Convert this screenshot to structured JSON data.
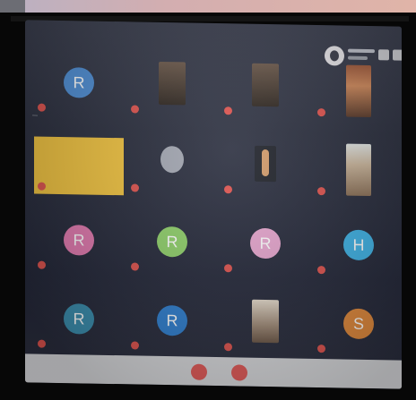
{
  "colors": {
    "screen_bg": "#2b2f3f",
    "active_speaker": "#f2c440",
    "mic_muted": "#e0544f",
    "avatar_colors": [
      "#4f8fd6",
      "#e37ab0",
      "#8fd06a",
      "#e7a6cf",
      "#3fb4e8",
      "#3b8fb0",
      "#2f7fd0",
      "#e28a3c"
    ]
  },
  "host": {
    "icon": "person-avatar-icon"
  },
  "toolbar": {
    "buttons": [
      "layout-icon",
      "fullscreen-icon"
    ]
  },
  "participants": [
    {
      "initial": "R",
      "name": "",
      "kind": "avatar",
      "color_index": 0
    },
    {
      "initial": "",
      "name": "",
      "kind": "photo"
    },
    {
      "initial": "",
      "name": "",
      "kind": "photo"
    },
    {
      "initial": "",
      "name": "",
      "kind": "portrait"
    },
    {
      "initial": "",
      "name": "",
      "kind": "active"
    },
    {
      "initial": "",
      "name": "",
      "kind": "photo-round"
    },
    {
      "initial": "",
      "name": "",
      "kind": "icon"
    },
    {
      "initial": "",
      "name": "",
      "kind": "portrait2"
    },
    {
      "initial": "R",
      "name": "",
      "kind": "avatar",
      "color_index": 1
    },
    {
      "initial": "R",
      "name": "",
      "kind": "avatar",
      "color_index": 2
    },
    {
      "initial": "R",
      "name": "",
      "kind": "avatar",
      "color_index": 3
    },
    {
      "initial": "H",
      "name": "",
      "kind": "avatar",
      "color_index": 4
    },
    {
      "initial": "R",
      "name": "",
      "kind": "avatar",
      "color_index": 5
    },
    {
      "initial": "R",
      "name": "",
      "kind": "avatar",
      "color_index": 6
    },
    {
      "initial": "",
      "name": "",
      "kind": "photo-light"
    },
    {
      "initial": "S",
      "name": "",
      "kind": "avatar",
      "color_index": 7
    }
  ],
  "controls": [
    "mute-icon",
    "leave-icon"
  ]
}
